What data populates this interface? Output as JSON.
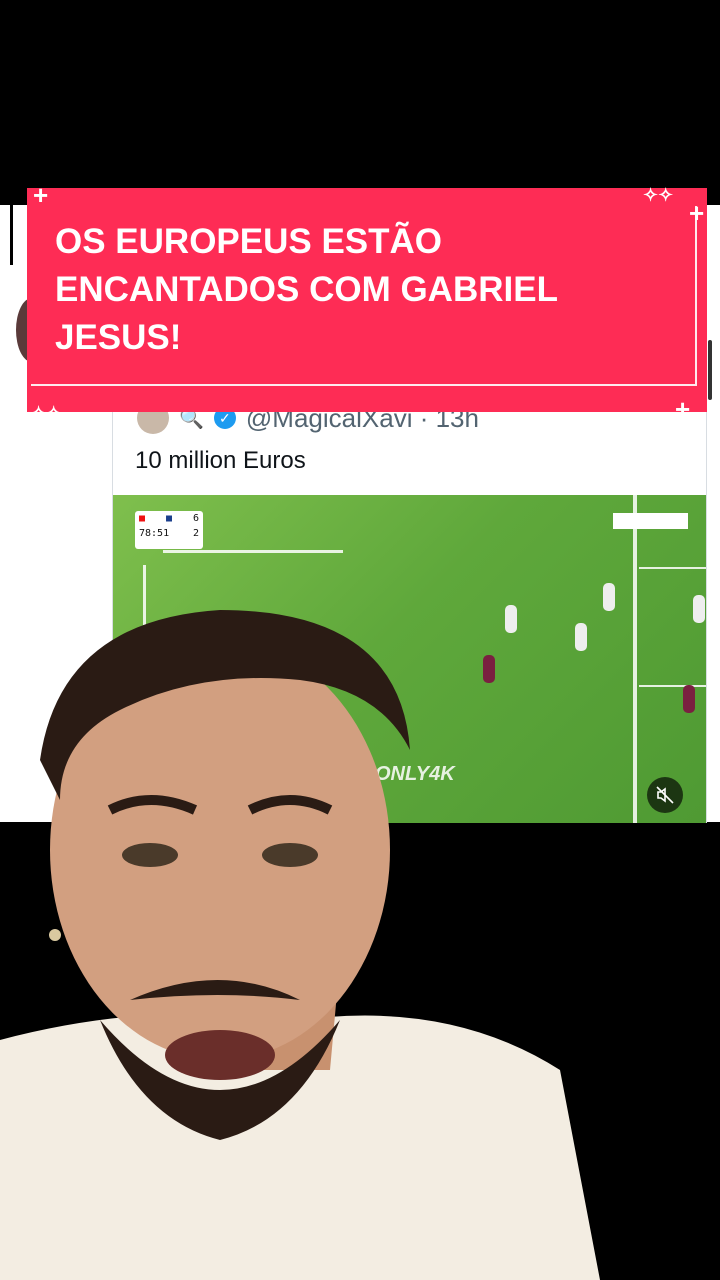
{
  "banner": {
    "title": "OS EUROPEUS ESTÃO ENCANTADOS COM GABRIEL JESUS!"
  },
  "quoted_tweet": {
    "handle_time": "@MagicalXavi · 13h",
    "text": "10 million Euros",
    "video": {
      "watermark": "ONLY4K",
      "scoreboard": {
        "time": "78:51",
        "home_score": "6",
        "away_score": "2"
      },
      "mute_icon": "speaker-muted-icon"
    }
  },
  "colors": {
    "banner": "#fe2c55",
    "pitch": "#5fa83b",
    "verified": "#1d9bf0"
  }
}
